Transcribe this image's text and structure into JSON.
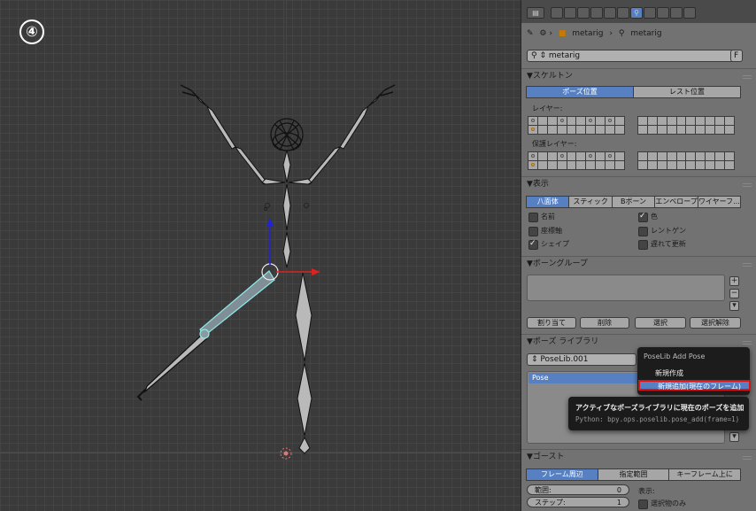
{
  "step_marker": "④",
  "breadcrumb": {
    "object": "metarig",
    "armature": "metarig"
  },
  "armature_field": {
    "value": "metarig",
    "fake_user": "F"
  },
  "skeleton": {
    "title": "▼スケルトン",
    "pose_position": "ポーズ位置",
    "rest_position": "レスト位置",
    "layers_label": "レイヤー:",
    "protected_layers_label": "保護レイヤー:"
  },
  "display": {
    "title": "▼表示",
    "modes": [
      "八面体",
      "スティック",
      "Bボーン",
      "エンベロープ",
      "ワイヤーフ..."
    ],
    "active_mode": 0,
    "names": "名前",
    "axes": "座標軸",
    "shapes": "シェイプ",
    "colors": "色",
    "xray": "レントゲン",
    "delay_refresh": "遅れて更新"
  },
  "bone_groups": {
    "title": "▼ボーングループ",
    "assign": "割り当て",
    "remove": "削除",
    "select": "選択",
    "deselect": "選択解除"
  },
  "pose_library": {
    "title": "▼ポーズ ライブラリ",
    "library_name": "PoseLib.001",
    "pose_item": "Pose"
  },
  "popup": {
    "title": "PoseLib Add Pose",
    "items": [
      "新規作成",
      "新規追加(現在のフレーム)"
    ],
    "highlighted": 1
  },
  "tooltip": {
    "description": "アクティブなポーズライブラリに現在のポーズを追加",
    "python": "Python: bpy.ops.poselib.pose_add(frame=1)"
  },
  "ghost": {
    "title": "▼ゴースト",
    "modes": [
      "フレーム周辺",
      "指定範囲",
      "キーフレーム上に"
    ],
    "active_mode": 0,
    "range_label": "範囲:",
    "range_value": "0",
    "step_label": "ステップ:",
    "step_value": "1",
    "display_label": "表示:",
    "selected_only": "選択物のみ"
  },
  "colors": {
    "accent": "#5680c2",
    "highlight_border": "#dd1111",
    "viewport_bg": "#3a3a3a",
    "panel_bg": "#727272"
  }
}
